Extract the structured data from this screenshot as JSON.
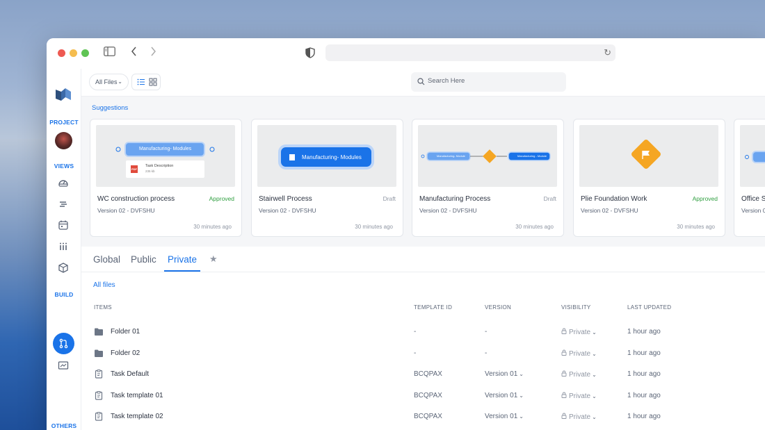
{
  "browser": {
    "url": ""
  },
  "sidebar": {
    "project_label": "PROJECT",
    "views_label": "VIEWS",
    "build_label": "BUILD",
    "others_label": "OTHERS",
    "icons": [
      "dashboard-icon",
      "list-icon",
      "calendar-icon",
      "columns-icon",
      "cube-icon",
      "git-pull-request-icon",
      "presentation-icon"
    ]
  },
  "toolbar": {
    "filter_label": "All Files",
    "search_placeholder": "Search Here"
  },
  "suggestions": {
    "label": "Suggestions",
    "cards": [
      {
        "title": "WC construction process",
        "status": "Approved",
        "version": "Version 02 -  DVFSHU",
        "time": "30 minutes ago",
        "thumb_label": "Manufacturing- Modules",
        "thumb_sub": "Task Description",
        "thumb_size": "235 kb",
        "thumb_pdf": "PDF"
      },
      {
        "title": "Stairwell Process",
        "status": "Draft",
        "version": "Version 02 -  DVFSHU",
        "time": "30 minutes ago",
        "thumb_label": "Manufacturing- Modules"
      },
      {
        "title": "Manufacturing Process",
        "status": "Draft",
        "version": "Version 02 -  DVFSHU",
        "time": "30 minutes ago",
        "thumb_label_a": "Manufacturing- Module",
        "thumb_label_b": "Manufacturing - Module"
      },
      {
        "title": "Plie Foundation Work",
        "status": "Approved",
        "version": "Version 02 -  DVFSHU",
        "time": "30 minutes ago"
      },
      {
        "title": "Office S",
        "version": "Version 0"
      }
    ]
  },
  "tabs": {
    "global": "Global",
    "public": "Public",
    "private": "Private",
    "active": "Private"
  },
  "table": {
    "breadcrumb": "All files",
    "headers": {
      "items": "ITEMS",
      "template_id": "TEMPLATE ID",
      "version": "VERSION",
      "visibility": "VISIBILITY",
      "last_updated": "LAST UPDATED"
    },
    "rows": [
      {
        "type": "folder",
        "name": "Folder 01",
        "template_id": "-",
        "version": "-",
        "visibility": "Private",
        "updated": "1 hour ago"
      },
      {
        "type": "folder",
        "name": "Folder 02",
        "template_id": "-",
        "version": "-",
        "visibility": "Private",
        "updated": "1 hour ago"
      },
      {
        "type": "template",
        "name": "Task Default",
        "template_id": "BCQPAX",
        "version": "Version 01",
        "visibility": "Private",
        "updated": "1 hour ago"
      },
      {
        "type": "template",
        "name": "Task template 01",
        "template_id": "BCQPAX",
        "version": "Version 01",
        "visibility": "Private",
        "updated": "1 hour ago"
      },
      {
        "type": "template",
        "name": "Task template 02",
        "template_id": "BCQPAX",
        "version": "Version 01",
        "visibility": "Private",
        "updated": "1 hour ago"
      }
    ]
  },
  "colors": {
    "accent": "#1a73e8",
    "approved": "#2e9e3f",
    "draft": "#8f96a3",
    "diamond": "#f5a623"
  }
}
